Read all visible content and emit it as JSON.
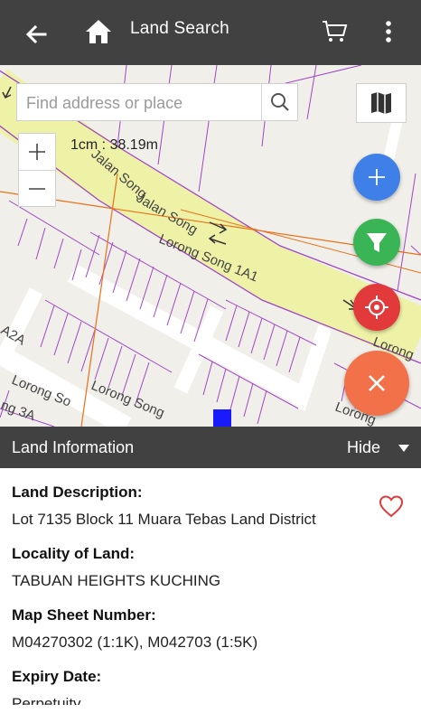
{
  "appbar": {
    "title": "Land Search",
    "back_icon": "arrow-left-icon",
    "home_icon": "home-icon",
    "cart_icon": "cart-icon",
    "more_icon": "more-vertical-icon"
  },
  "map": {
    "search_placeholder": "Find address or place",
    "search_value": "",
    "scale_label": "1cm : 38.19m",
    "street_labels": [
      "Jalan Song",
      "Jalan Song",
      "Lorong Song 1A1",
      "Lorong Song",
      "Lorong So",
      "Lorong",
      "Lorong",
      "ng 3A",
      "A2A"
    ],
    "fab_colors": {
      "add": "#3f7fe8",
      "filter": "#3ab556",
      "locate": "#e23a3a",
      "close": "#f37149"
    }
  },
  "panel": {
    "title": "Land Information",
    "hide_label": "Hide",
    "fields": [
      {
        "label": "Land Description:",
        "value": "Lot 7135 Block 11 Muara Tebas Land District"
      },
      {
        "label": "Locality of Land:",
        "value": "TABUAN HEIGHTS KUCHING"
      },
      {
        "label": "Map Sheet Number:",
        "value": "M04270302 (1:1K), M042703 (1:5K)"
      },
      {
        "label": "Expiry Date:",
        "value": "Perpetuity"
      }
    ]
  }
}
